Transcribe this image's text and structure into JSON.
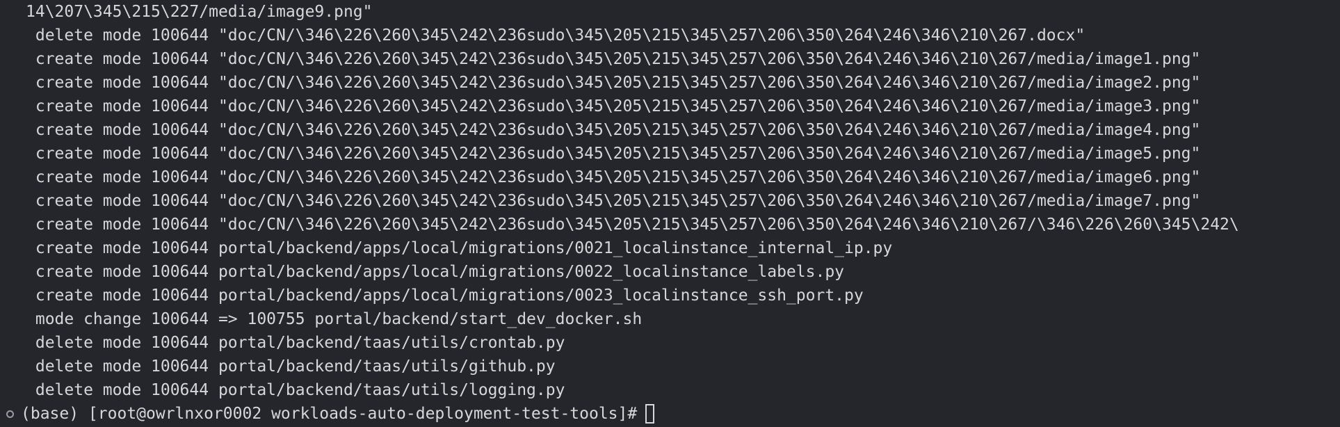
{
  "terminal": {
    "lines": [
      "14\\207\\345\\215\\227/media/image9.png\"",
      " delete mode 100644 \"doc/CN/\\346\\226\\260\\345\\242\\236sudo\\345\\205\\215\\345\\257\\206\\350\\264\\246\\346\\210\\267.docx\"",
      " create mode 100644 \"doc/CN/\\346\\226\\260\\345\\242\\236sudo\\345\\205\\215\\345\\257\\206\\350\\264\\246\\346\\210\\267/media/image1.png\"",
      " create mode 100644 \"doc/CN/\\346\\226\\260\\345\\242\\236sudo\\345\\205\\215\\345\\257\\206\\350\\264\\246\\346\\210\\267/media/image2.png\"",
      " create mode 100644 \"doc/CN/\\346\\226\\260\\345\\242\\236sudo\\345\\205\\215\\345\\257\\206\\350\\264\\246\\346\\210\\267/media/image3.png\"",
      " create mode 100644 \"doc/CN/\\346\\226\\260\\345\\242\\236sudo\\345\\205\\215\\345\\257\\206\\350\\264\\246\\346\\210\\267/media/image4.png\"",
      " create mode 100644 \"doc/CN/\\346\\226\\260\\345\\242\\236sudo\\345\\205\\215\\345\\257\\206\\350\\264\\246\\346\\210\\267/media/image5.png\"",
      " create mode 100644 \"doc/CN/\\346\\226\\260\\345\\242\\236sudo\\345\\205\\215\\345\\257\\206\\350\\264\\246\\346\\210\\267/media/image6.png\"",
      " create mode 100644 \"doc/CN/\\346\\226\\260\\345\\242\\236sudo\\345\\205\\215\\345\\257\\206\\350\\264\\246\\346\\210\\267/media/image7.png\"",
      " create mode 100644 \"doc/CN/\\346\\226\\260\\345\\242\\236sudo\\345\\205\\215\\345\\257\\206\\350\\264\\246\\346\\210\\267/\\346\\226\\260\\345\\242\\",
      " create mode 100644 portal/backend/apps/local/migrations/0021_localinstance_internal_ip.py",
      " create mode 100644 portal/backend/apps/local/migrations/0022_localinstance_labels.py",
      " create mode 100644 portal/backend/apps/local/migrations/0023_localinstance_ssh_port.py",
      " mode change 100644 => 100755 portal/backend/start_dev_docker.sh",
      " delete mode 100644 portal/backend/taas/utils/crontab.py",
      " delete mode 100644 portal/backend/taas/utils/github.py",
      " delete mode 100644 portal/backend/taas/utils/logging.py"
    ],
    "prompt": "(base) [root@owrlnxor0002 workloads-auto-deployment-test-tools]#",
    "status_icon": "circle-status-icon",
    "cursor_icon": "block-cursor-icon"
  }
}
